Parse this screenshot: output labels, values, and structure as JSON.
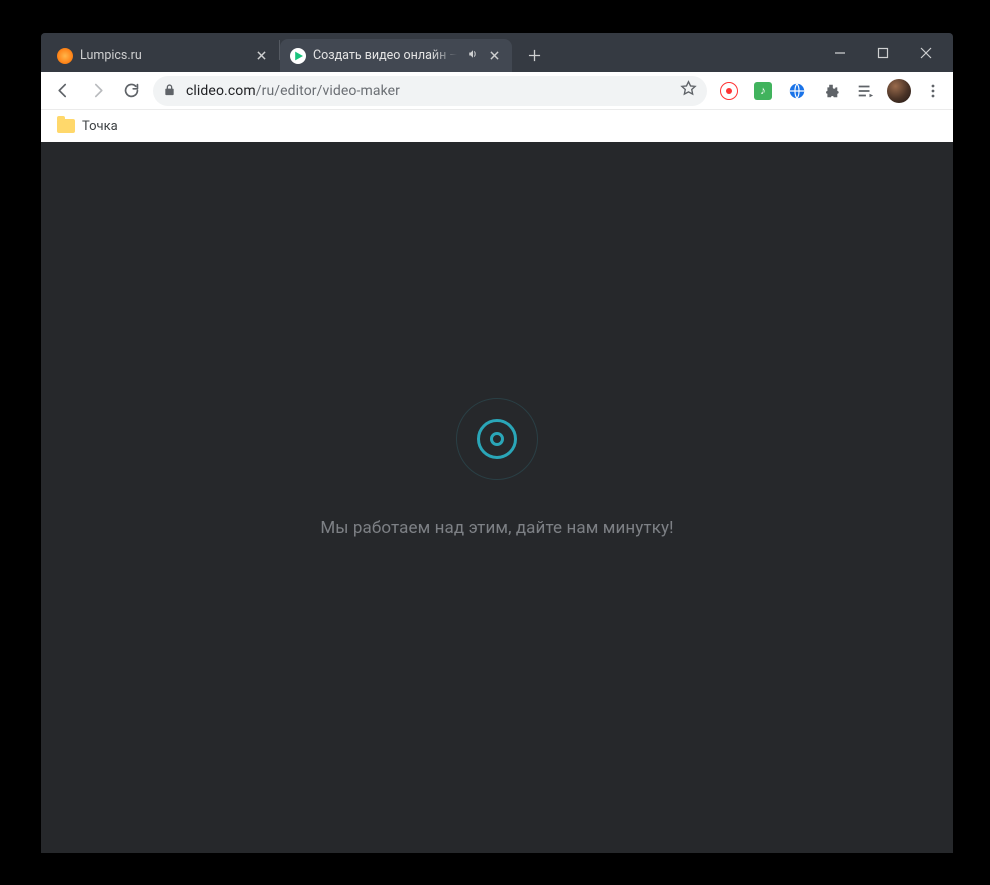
{
  "window_controls": {
    "minimize": "minimize",
    "maximize": "maximize",
    "close": "close"
  },
  "tabs": [
    {
      "title": "Lumpics.ru",
      "active": false,
      "favicon": "orange"
    },
    {
      "title": "Создать видео онлайн — Clideo",
      "active": true,
      "favicon": "play",
      "audio": true
    }
  ],
  "navigation": {
    "back": "back",
    "forward": "forward",
    "reload": "reload"
  },
  "address": {
    "secure": true,
    "host": "clideo.com",
    "path": "/ru/editor/video-maker"
  },
  "extensions": {
    "yandex": "yandex",
    "music": "yandex-music",
    "translate": "google-translate",
    "extensions_menu": "extensions",
    "media_queue": "media-control"
  },
  "profile": {
    "name": "profile-avatar"
  },
  "bookmarks": [
    {
      "label": "Точка",
      "type": "folder"
    }
  ],
  "page": {
    "loading_message": "Мы работаем над этим, дайте нам минутку!"
  },
  "colors": {
    "page_bg": "#26282b",
    "accent": "#2aa6b8",
    "tabstrip_bg": "#353a42",
    "active_tab_bg": "#424852"
  }
}
